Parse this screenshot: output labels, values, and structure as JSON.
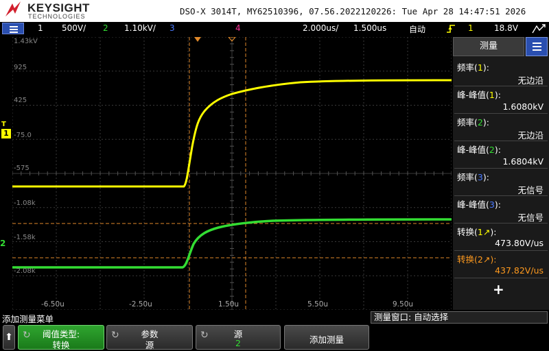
{
  "header": {
    "brand": "KEYSIGHT",
    "brand_sub": "TECHNOLOGIES",
    "title": "DSO-X 3014T, MY62510396, 07.56.2022120226: Tue Apr 28 14:47:51 2026"
  },
  "channel_bar": {
    "ch1_num": "1",
    "ch1_scale": "500V/",
    "ch2_num": "2",
    "ch2_scale": "1.10kV/",
    "ch3_num": "3",
    "ch4_num": "4",
    "timebase": "2.000us/",
    "delay": "1.500us",
    "trigger_mode": "自动",
    "trigger_icon": "rising-edge-icon",
    "trigger_source": "1",
    "trigger_level": "18.8V",
    "colors": {
      "ch1": "#ffff00",
      "ch2": "#33dd33",
      "ch3": "#4a7aff",
      "ch4": "#ff3399"
    }
  },
  "plot": {
    "y_labels": [
      "1.43kV",
      "925",
      "425",
      "-75.0",
      "-575",
      "-1.08k",
      "-1.58k",
      "-2.08k"
    ],
    "x_labels": [
      "-6.50u",
      "-2.50u",
      "1.50u",
      "5.50u",
      "9.50u"
    ],
    "ch1_marker": "1",
    "ch2_marker": "2",
    "trigger_marker": "T"
  },
  "panel": {
    "title": "测量",
    "measurements": [
      {
        "label": "频率",
        "ch": "1",
        "value": "无边沿"
      },
      {
        "label": "峰-峰值",
        "ch": "1",
        "value": "1.6080kV"
      },
      {
        "label": "频率",
        "ch": "2",
        "value": "无边沿"
      },
      {
        "label": "峰-峰值",
        "ch": "2",
        "value": "1.6804kV"
      },
      {
        "label": "频率",
        "ch": "3",
        "value": "无信号"
      },
      {
        "label": "峰-峰值",
        "ch": "3",
        "value": "无信号"
      }
    ],
    "slew1": {
      "label": "转换",
      "ch": "1",
      "value": "473.80V/us"
    },
    "slew2": {
      "label": "转换",
      "ch": "2",
      "value": "437.82V/us"
    },
    "add_symbol": "+"
  },
  "softmenu": {
    "title": "添加测量菜单",
    "window": "测量窗口: 自动选择",
    "keys": [
      {
        "l1": "阈值类型:",
        "l2": "转换"
      },
      {
        "l1": "参数",
        "l2": "源"
      },
      {
        "l1": "源",
        "l2": "2"
      },
      {
        "l1": "添加测量",
        "l2": ""
      }
    ]
  }
}
